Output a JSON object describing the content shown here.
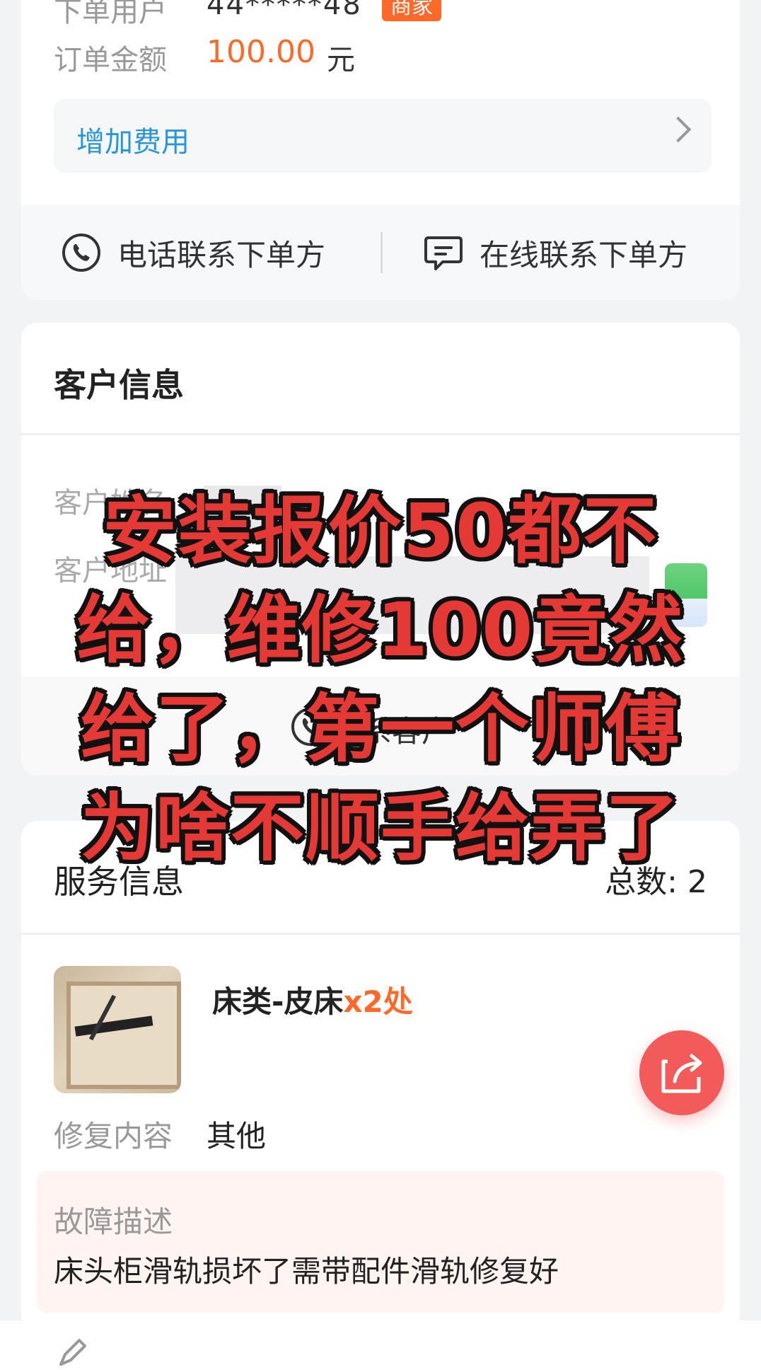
{
  "order": {
    "user_label": "下单用户",
    "user_value": "44*****48",
    "user_tag": "商家",
    "amount_label": "订单金额",
    "amount_value": "100.00",
    "amount_unit": "元",
    "add_fee_label": "增加费用"
  },
  "contact": {
    "phone_label": "电话联系下单方",
    "online_label": "在线联系下单方"
  },
  "customer": {
    "title": "客户信息",
    "name_label": "客户姓名",
    "address_label": "客户地址",
    "contact_label": "联系客户"
  },
  "service": {
    "title": "服务信息",
    "total_label": "总数: 2",
    "item_name": "床类-皮床",
    "item_qty": "x2处",
    "repair_label": "修复内容",
    "repair_value": "其他",
    "fault_title": "故障描述",
    "fault_text": "床头柜滑轨损坏了需带配件滑轨修复好"
  },
  "overlay": {
    "lines": [
      "安装报价50都不",
      "给，维修100竟然",
      "给了，第一个师傅",
      "为啥不顺手给弄了"
    ]
  },
  "colors": {
    "accent_orange": "#ff6a2b",
    "link_blue": "#2a95d8",
    "fab_red": "#f35a5a",
    "overlay_red": "#e53935"
  }
}
